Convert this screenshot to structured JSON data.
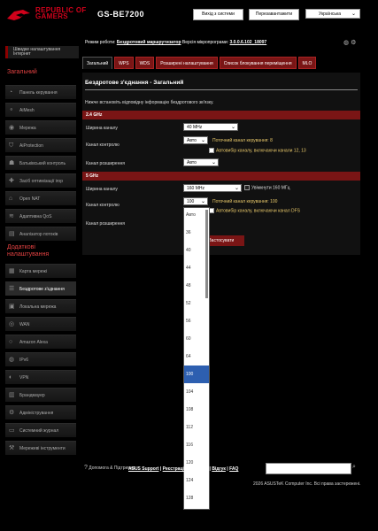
{
  "header": {
    "brand_line1": "REPUBLIC OF",
    "brand_line2": "GAMERS",
    "model": "GS-BE7200",
    "logout": "Вихід з системи",
    "reboot": "Перезавантажити",
    "language": "Українська"
  },
  "sidebar": {
    "quick_setup": "Швидке налаштування Інтернет",
    "general_title": "Загальний",
    "general_items": [
      {
        "label": "Панель керування",
        "icon": "dashboard-icon"
      },
      {
        "label": "AiMesh",
        "icon": "aimesh-icon"
      },
      {
        "label": "Мережа",
        "icon": "network-icon"
      },
      {
        "label": "AiProtection",
        "icon": "shield-icon"
      },
      {
        "label": "Батьківський контроль",
        "icon": "parental-icon"
      },
      {
        "label": "Засіб оптимізації ігор",
        "icon": "game-boost-icon"
      },
      {
        "label": "Open NAT",
        "icon": "open-nat-icon"
      },
      {
        "label": "Адаптивна QoS",
        "icon": "qos-icon"
      },
      {
        "label": "Аналізатор потоків",
        "icon": "traffic-analyzer-icon"
      }
    ],
    "advanced_title": "Додаткові налаштування",
    "advanced_items": [
      {
        "label": "Карта мережі",
        "icon": "network-map-icon"
      },
      {
        "label": "Бездротове з'єднання",
        "icon": "wireless-icon",
        "active": true
      },
      {
        "label": "Локальна мережа",
        "icon": "lan-icon"
      },
      {
        "label": "WAN",
        "icon": "wan-icon"
      },
      {
        "label": "Amazon Alexa",
        "icon": "alexa-icon"
      },
      {
        "label": "IPv6",
        "icon": "ipv6-icon"
      },
      {
        "label": "VPN",
        "icon": "vpn-icon"
      },
      {
        "label": "Брандмауер",
        "icon": "firewall-icon"
      },
      {
        "label": "Адміністрування",
        "icon": "admin-icon"
      },
      {
        "label": "Системний журнал",
        "icon": "log-icon"
      },
      {
        "label": "Мережеві інструменти",
        "icon": "tools-icon"
      }
    ]
  },
  "status": {
    "mode_label": "Режим роботи:",
    "mode_value": "Бездротовий маршрутизатор",
    "fw_label": "Версія мікропрограми:",
    "fw_value": "3.0.0.6.102_18097"
  },
  "tabs": [
    "Загальний",
    "WPS",
    "WDS",
    "Розширені налаштування",
    "Список блокування переміщення",
    "MLO"
  ],
  "panel": {
    "title": "Бездротове з'єднання - Загальний",
    "desc": "Нижче встановіть відповідну інформацію бездротового зв'язку.",
    "band24": {
      "title": "2.4 GHz",
      "width_label": "Ширина каналу",
      "width_value": "40 MHz",
      "control_label": "Канал контролю",
      "control_value": "Авто",
      "current_control": "Поточний канал керування: 8",
      "auto_select_note": "Автовибір каналу, включаючи канали 12, 13",
      "ext_label": "Канал розширення",
      "ext_value": "Авто"
    },
    "band5": {
      "title": "5 GHz",
      "width_label": "Ширина каналу",
      "width_value": "160 MHz",
      "enable160": "Увімкнути 160 МГц",
      "control_label": "Канал контролю",
      "control_value": "100",
      "current_control": "Поточний канал керування: 100",
      "dfs_note": "Автовибір каналу, включаючи канал DFS",
      "ext_label": "Канал розширення"
    },
    "apply": "Застосувати"
  },
  "dropdown": {
    "options": [
      "Авто",
      "36",
      "40",
      "44",
      "48",
      "52",
      "56",
      "60",
      "64",
      "100",
      "104",
      "108",
      "112",
      "116",
      "120",
      "124",
      "128"
    ],
    "selected": "100"
  },
  "footer": {
    "help": "Допомога & Підтримка",
    "links": [
      "ASUS Support",
      "Реєстрація продукту",
      "Відгук",
      "FAQ"
    ],
    "copyright": "2026 ASUSTeK Computer Inc. Всі права застережені."
  },
  "colors": {
    "accent_red": "#7a1515",
    "brand_red": "#d0021b",
    "highlight_blue": "#2d5fb0",
    "note_yellow": "#e8c86a"
  }
}
